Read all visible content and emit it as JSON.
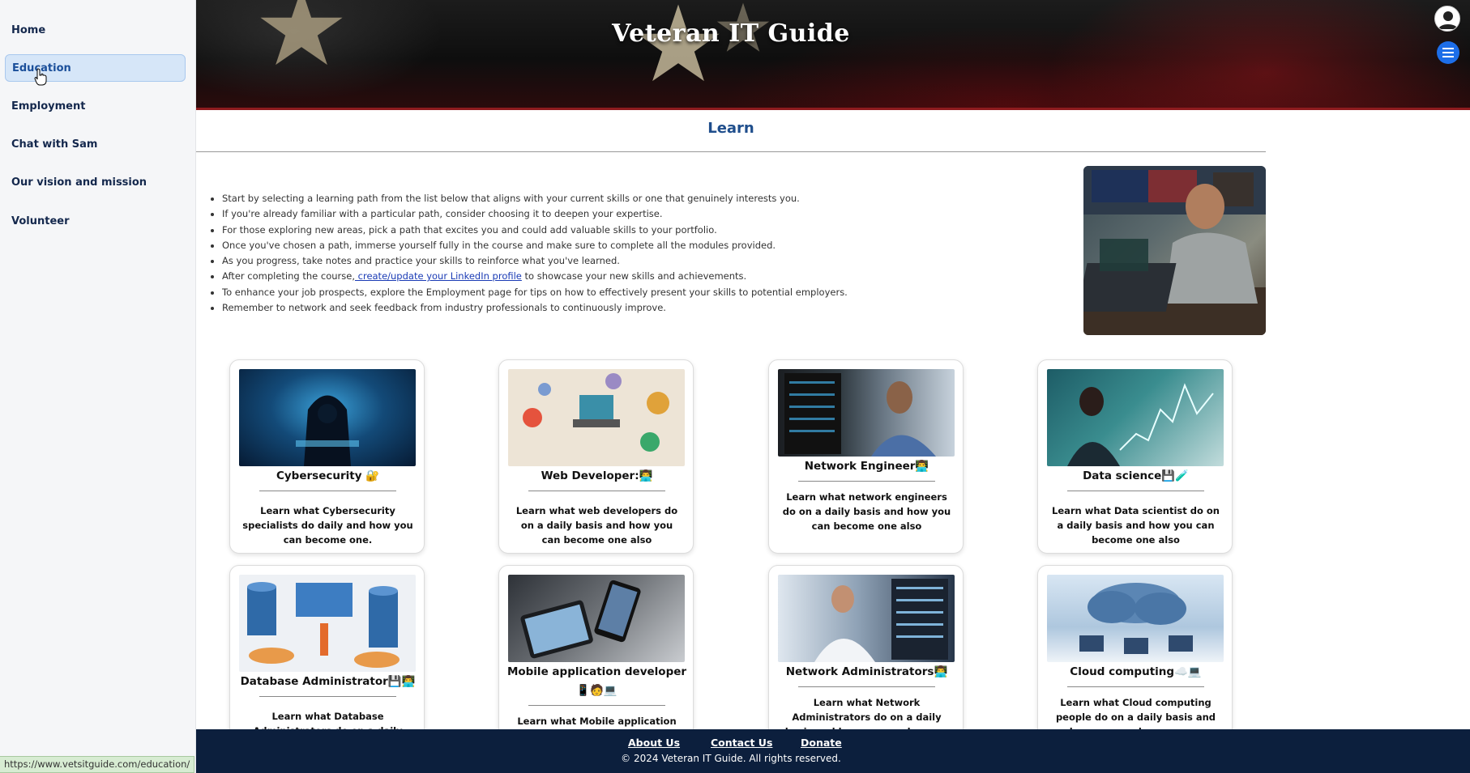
{
  "sidebar": {
    "items": [
      {
        "label": "Home",
        "active": false
      },
      {
        "label": "Education",
        "active": true
      },
      {
        "label": "Employment",
        "active": false
      },
      {
        "label": "Chat with Sam",
        "active": false
      },
      {
        "label": "Our vision and mission",
        "active": false
      },
      {
        "label": "Volunteer",
        "active": false
      }
    ]
  },
  "header": {
    "title": "Veteran IT Guide",
    "profile_icon": "user-circle-icon",
    "menu_icon": "hamburger-menu-icon"
  },
  "main": {
    "section_title": "Learn",
    "intro_items": [
      {
        "text": "Start by selecting a learning path from the list below that aligns with your current skills or one that genuinely interests you."
      },
      {
        "text": "If you're already familiar with a particular path, consider choosing it to deepen your expertise."
      },
      {
        "text": "For those exploring new areas, pick a path that excites you and could add valuable skills to your portfolio."
      },
      {
        "text": "Once you've chosen a path, immerse yourself fully in the course and make sure to complete all the modules provided."
      },
      {
        "text": "As you progress, take notes and practice your skills to reinforce what you've learned."
      },
      {
        "before": "After completing the course,",
        "link": " create/update your LinkedIn profile",
        "after": " to showcase your new skills and achievements."
      },
      {
        "text": "To enhance your job prospects, explore the Employment page for tips on how to effectively present your skills to potential employers."
      },
      {
        "text": "Remember to network and seek feedback from industry professionals to continuously improve."
      }
    ],
    "hero_image": "veteran-at-laptop-photo"
  },
  "cards": [
    {
      "title": "Cybersecurity 🔐",
      "description": "Learn what Cybersecurity specialists do daily and how you can become one."
    },
    {
      "title": "Web Developer:👨‍💻",
      "description": "Learn what web developers do on a daily basis and how you can become one also"
    },
    {
      "title": "Network Engineer👨‍💻",
      "description": "Learn what network engineers do on a daily basis and how you can become one also"
    },
    {
      "title": "Data science💾🧪",
      "description": "Learn what Data scientist do on a daily basis and how you can become one also"
    },
    {
      "title": "Database Administrator💾👨‍💻",
      "description": "Learn what Database Administrators do on a daily basis and how you can become one"
    },
    {
      "title": "Mobile application developer📱🧑💻",
      "description": "Learn what Mobile application developers"
    },
    {
      "title": "Network Administrators👨‍💻",
      "description": "Learn what Network Administrators do on a daily basis and how you can become one"
    },
    {
      "title": "Cloud computing☁️💻",
      "description": "Learn what Cloud computing people do on a daily basis and how you can become one"
    }
  ],
  "footer": {
    "links": [
      "About Us",
      "Contact Us",
      "Donate"
    ],
    "copyright": "© 2024 Veteran IT Guide. All rights reserved."
  },
  "statusbar": {
    "url": "https://www.vetsitguide.com/education/"
  },
  "colors": {
    "accent": "#1f4e8c",
    "footer_bg": "#0c1f3d",
    "nav_active_bg": "#d6e6f8",
    "menu_button": "#1d6ee8"
  }
}
